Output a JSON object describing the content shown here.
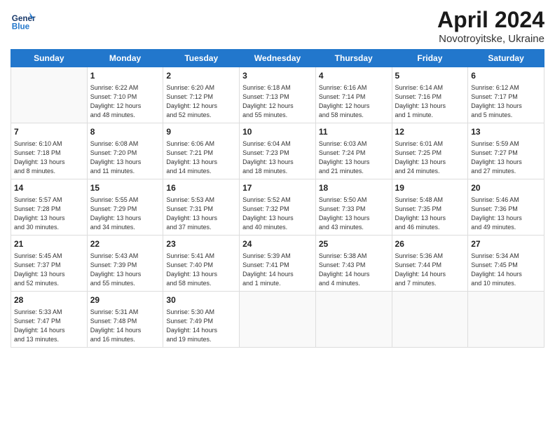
{
  "header": {
    "logo_general": "General",
    "logo_blue": "Blue",
    "title": "April 2024",
    "subtitle": "Novotroyitske, Ukraine"
  },
  "weekdays": [
    "Sunday",
    "Monday",
    "Tuesday",
    "Wednesday",
    "Thursday",
    "Friday",
    "Saturday"
  ],
  "weeks": [
    [
      {
        "day": "",
        "info": ""
      },
      {
        "day": "1",
        "info": "Sunrise: 6:22 AM\nSunset: 7:10 PM\nDaylight: 12 hours\nand 48 minutes."
      },
      {
        "day": "2",
        "info": "Sunrise: 6:20 AM\nSunset: 7:12 PM\nDaylight: 12 hours\nand 52 minutes."
      },
      {
        "day": "3",
        "info": "Sunrise: 6:18 AM\nSunset: 7:13 PM\nDaylight: 12 hours\nand 55 minutes."
      },
      {
        "day": "4",
        "info": "Sunrise: 6:16 AM\nSunset: 7:14 PM\nDaylight: 12 hours\nand 58 minutes."
      },
      {
        "day": "5",
        "info": "Sunrise: 6:14 AM\nSunset: 7:16 PM\nDaylight: 13 hours\nand 1 minute."
      },
      {
        "day": "6",
        "info": "Sunrise: 6:12 AM\nSunset: 7:17 PM\nDaylight: 13 hours\nand 5 minutes."
      }
    ],
    [
      {
        "day": "7",
        "info": "Sunrise: 6:10 AM\nSunset: 7:18 PM\nDaylight: 13 hours\nand 8 minutes."
      },
      {
        "day": "8",
        "info": "Sunrise: 6:08 AM\nSunset: 7:20 PM\nDaylight: 13 hours\nand 11 minutes."
      },
      {
        "day": "9",
        "info": "Sunrise: 6:06 AM\nSunset: 7:21 PM\nDaylight: 13 hours\nand 14 minutes."
      },
      {
        "day": "10",
        "info": "Sunrise: 6:04 AM\nSunset: 7:23 PM\nDaylight: 13 hours\nand 18 minutes."
      },
      {
        "day": "11",
        "info": "Sunrise: 6:03 AM\nSunset: 7:24 PM\nDaylight: 13 hours\nand 21 minutes."
      },
      {
        "day": "12",
        "info": "Sunrise: 6:01 AM\nSunset: 7:25 PM\nDaylight: 13 hours\nand 24 minutes."
      },
      {
        "day": "13",
        "info": "Sunrise: 5:59 AM\nSunset: 7:27 PM\nDaylight: 13 hours\nand 27 minutes."
      }
    ],
    [
      {
        "day": "14",
        "info": "Sunrise: 5:57 AM\nSunset: 7:28 PM\nDaylight: 13 hours\nand 30 minutes."
      },
      {
        "day": "15",
        "info": "Sunrise: 5:55 AM\nSunset: 7:29 PM\nDaylight: 13 hours\nand 34 minutes."
      },
      {
        "day": "16",
        "info": "Sunrise: 5:53 AM\nSunset: 7:31 PM\nDaylight: 13 hours\nand 37 minutes."
      },
      {
        "day": "17",
        "info": "Sunrise: 5:52 AM\nSunset: 7:32 PM\nDaylight: 13 hours\nand 40 minutes."
      },
      {
        "day": "18",
        "info": "Sunrise: 5:50 AM\nSunset: 7:33 PM\nDaylight: 13 hours\nand 43 minutes."
      },
      {
        "day": "19",
        "info": "Sunrise: 5:48 AM\nSunset: 7:35 PM\nDaylight: 13 hours\nand 46 minutes."
      },
      {
        "day": "20",
        "info": "Sunrise: 5:46 AM\nSunset: 7:36 PM\nDaylight: 13 hours\nand 49 minutes."
      }
    ],
    [
      {
        "day": "21",
        "info": "Sunrise: 5:45 AM\nSunset: 7:37 PM\nDaylight: 13 hours\nand 52 minutes."
      },
      {
        "day": "22",
        "info": "Sunrise: 5:43 AM\nSunset: 7:39 PM\nDaylight: 13 hours\nand 55 minutes."
      },
      {
        "day": "23",
        "info": "Sunrise: 5:41 AM\nSunset: 7:40 PM\nDaylight: 13 hours\nand 58 minutes."
      },
      {
        "day": "24",
        "info": "Sunrise: 5:39 AM\nSunset: 7:41 PM\nDaylight: 14 hours\nand 1 minute."
      },
      {
        "day": "25",
        "info": "Sunrise: 5:38 AM\nSunset: 7:43 PM\nDaylight: 14 hours\nand 4 minutes."
      },
      {
        "day": "26",
        "info": "Sunrise: 5:36 AM\nSunset: 7:44 PM\nDaylight: 14 hours\nand 7 minutes."
      },
      {
        "day": "27",
        "info": "Sunrise: 5:34 AM\nSunset: 7:45 PM\nDaylight: 14 hours\nand 10 minutes."
      }
    ],
    [
      {
        "day": "28",
        "info": "Sunrise: 5:33 AM\nSunset: 7:47 PM\nDaylight: 14 hours\nand 13 minutes."
      },
      {
        "day": "29",
        "info": "Sunrise: 5:31 AM\nSunset: 7:48 PM\nDaylight: 14 hours\nand 16 minutes."
      },
      {
        "day": "30",
        "info": "Sunrise: 5:30 AM\nSunset: 7:49 PM\nDaylight: 14 hours\nand 19 minutes."
      },
      {
        "day": "",
        "info": ""
      },
      {
        "day": "",
        "info": ""
      },
      {
        "day": "",
        "info": ""
      },
      {
        "day": "",
        "info": ""
      }
    ]
  ]
}
